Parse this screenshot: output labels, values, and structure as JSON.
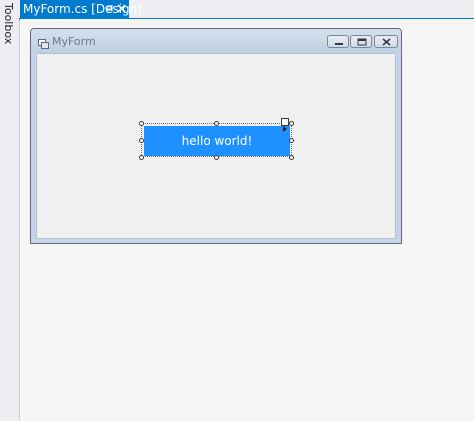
{
  "toolbox": {
    "label": "Toolbox"
  },
  "tab": {
    "title": "MyForm.cs [Design]",
    "pin_icon": "pin-icon",
    "close_icon": "close-icon"
  },
  "form": {
    "title": "MyForm",
    "icon": "form-icon",
    "caption_buttons": [
      "minimize",
      "maximize",
      "close"
    ]
  },
  "button": {
    "label": "hello world!",
    "color": "#1e90ff"
  },
  "colors": {
    "accent": "#007acc",
    "form_frame": "#c5d4e6",
    "client": "#f0f0f0"
  }
}
